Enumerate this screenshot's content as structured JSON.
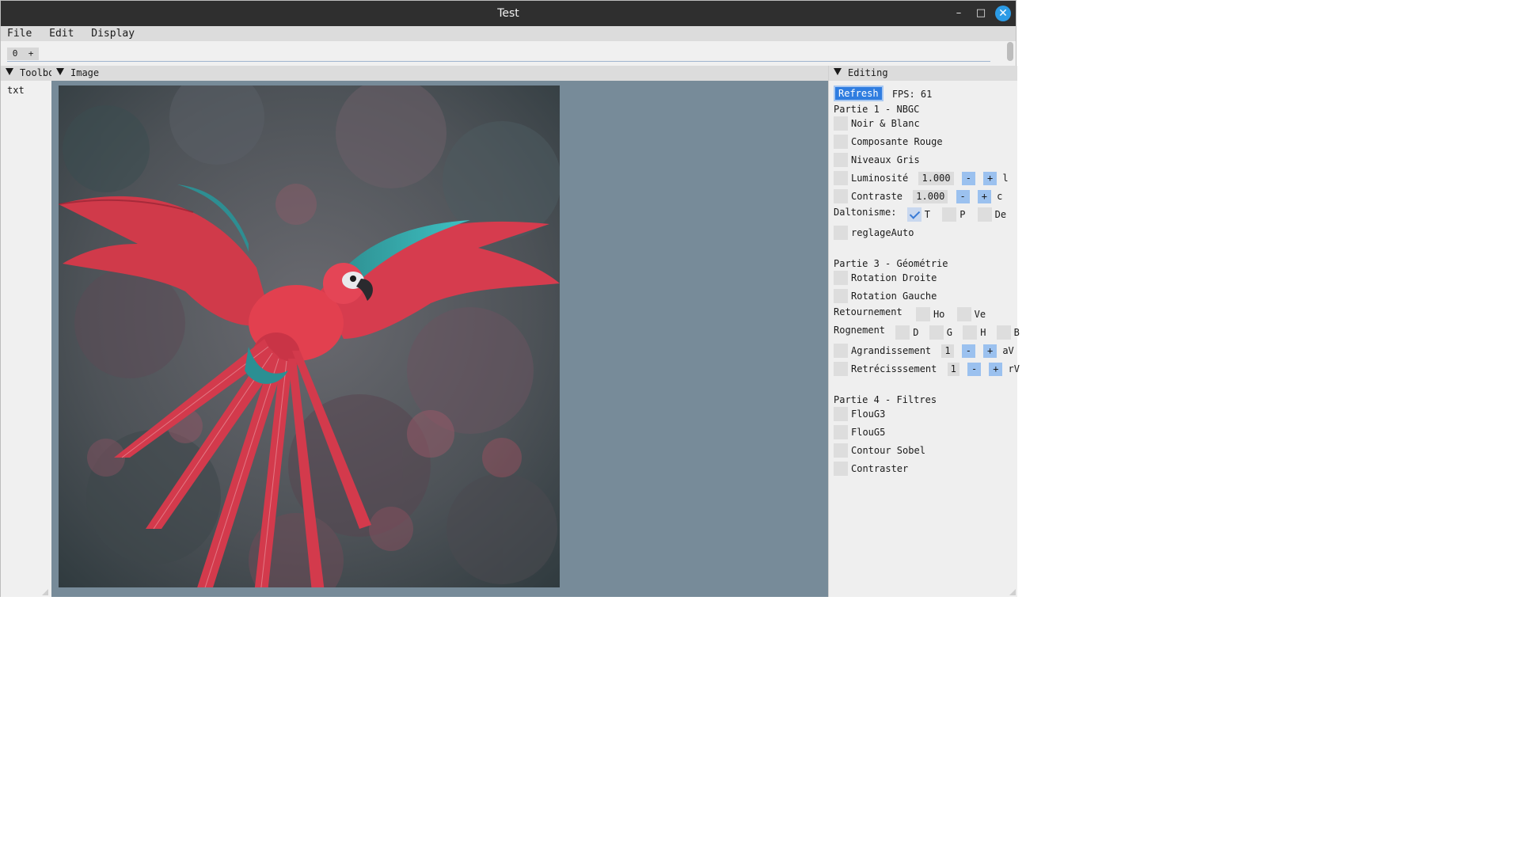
{
  "window": {
    "title": "Test",
    "minimize_glyph": "–",
    "maximize_glyph": "□",
    "close_glyph": "✕"
  },
  "menu": [
    "File",
    "Edit",
    "Display"
  ],
  "tabs": {
    "current": "0",
    "add": "+"
  },
  "toolbox": {
    "title": "Toolbox",
    "content": "txt"
  },
  "image_panel": {
    "title": "Image"
  },
  "editing": {
    "title": "Editing",
    "refresh_label": "Refresh",
    "fps": "FPS: 61",
    "part1": {
      "title": "Partie 1 - NBGC",
      "noir_blanc": "Noir & Blanc",
      "composante_rouge": "Composante Rouge",
      "niveaux_gris": "Niveaux Gris",
      "luminosite": {
        "label": "Luminosité",
        "value": "1.000",
        "minus": "-",
        "plus": "+",
        "key": "l"
      },
      "contraste": {
        "label": "Contraste",
        "value": "1.000",
        "minus": "-",
        "plus": "+",
        "key": "c"
      },
      "daltonisme": {
        "label": "Daltonisme:",
        "options": [
          "T",
          "P",
          "De"
        ]
      },
      "reglage_auto": "reglageAuto"
    },
    "part3": {
      "title": "Partie 3 - Géométrie",
      "rotation_droite": "Rotation Droite",
      "rotation_gauche": "Rotation Gauche",
      "retournement": {
        "label": "Retournement",
        "options": [
          "Ho",
          "Ve"
        ]
      },
      "rognement": {
        "label": "Rognement",
        "options": [
          "D",
          "G",
          "H",
          "B"
        ]
      },
      "agrandissement": {
        "label": "Agrandissement",
        "value": "1",
        "minus": "-",
        "plus": "+",
        "key": "aV"
      },
      "retrecissement": {
        "label": "Retrécisssement",
        "value": "1",
        "minus": "-",
        "plus": "+",
        "key": "rV"
      }
    },
    "part4": {
      "title": "Partie 4 - Filtres",
      "flou_g3": "FlouG3",
      "flou_g5": "FlouG5",
      "contour_sobel": "Contour Sobel",
      "contraster": "Contraster"
    }
  },
  "colors": {
    "titlebar": "#2f2f2f",
    "image_bg": "#778b99",
    "accent": "#2f7de0",
    "close": "#2b9be6"
  }
}
